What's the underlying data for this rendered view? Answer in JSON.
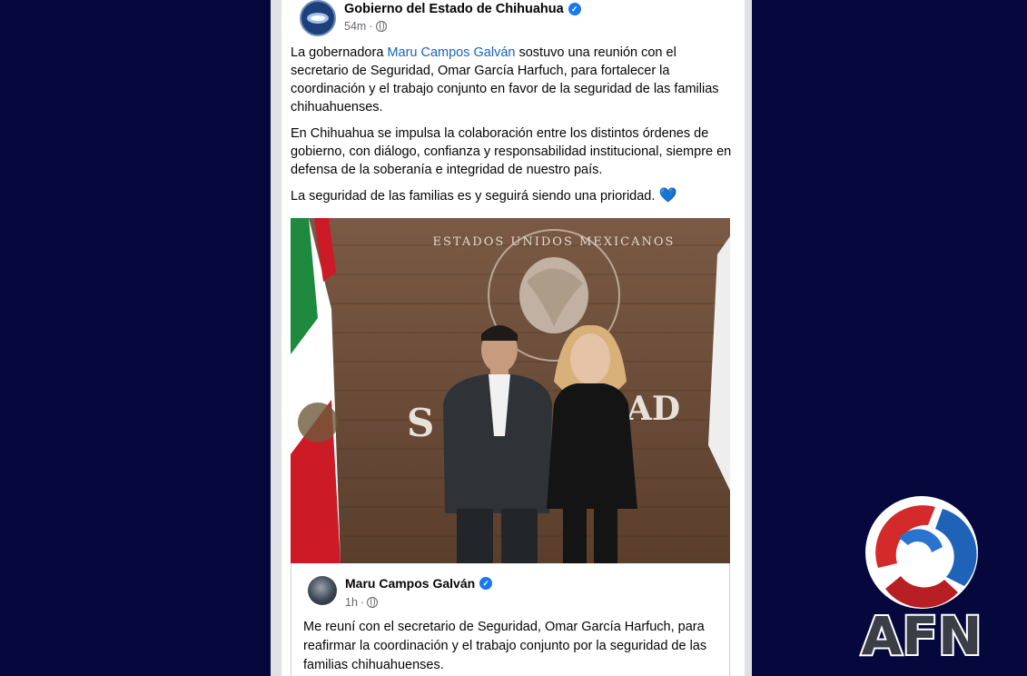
{
  "post": {
    "page_name": "Gobierno del Estado de Chihuahua",
    "time": "54m",
    "separator": "·",
    "paragraph1_prefix": "La gobernadora ",
    "mention": "Maru Campos Galván",
    "paragraph1_suffix": " sostuvo una reunión con el secretario de Seguridad, Omar García Harfuch, para fortalecer la coordinación y el trabajo conjunto en favor de la seguridad de las familias chihuahuenses.",
    "paragraph2": "En Chihuahua se impulsa la colaboración entre los distintos órdenes de gobierno, con diálogo, confianza y responsabilidad institucional, siempre en defensa de la soberanía e integridad de nuestro país.",
    "paragraph3": "La seguridad de las familias es y seguirá siendo una prioridad.",
    "heart_emoji": "💙"
  },
  "photo": {
    "seal_text": "ESTADOS UNIDOS MEXICANOS",
    "wall_text_left": "S",
    "wall_text_right": "AD"
  },
  "shared_post": {
    "author": "Maru Campos Galván",
    "time": "1h",
    "separator": "·",
    "text": "Me reuní con el secretario de Seguridad, Omar García Harfuch, para reafirmar la coordinación y el trabajo conjunto por la seguridad de las familias chihuahuenses."
  },
  "watermark": {
    "logo_text": "AFN"
  },
  "icons": {
    "verified": "verified-badge-icon",
    "globe": "globe-icon",
    "heart": "blue-heart-icon"
  },
  "colors": {
    "background": "#06083d",
    "mention": "#1563c9",
    "verified": "#1877f2",
    "logo_red": "#d42a2a",
    "logo_blue": "#1f63b8"
  }
}
